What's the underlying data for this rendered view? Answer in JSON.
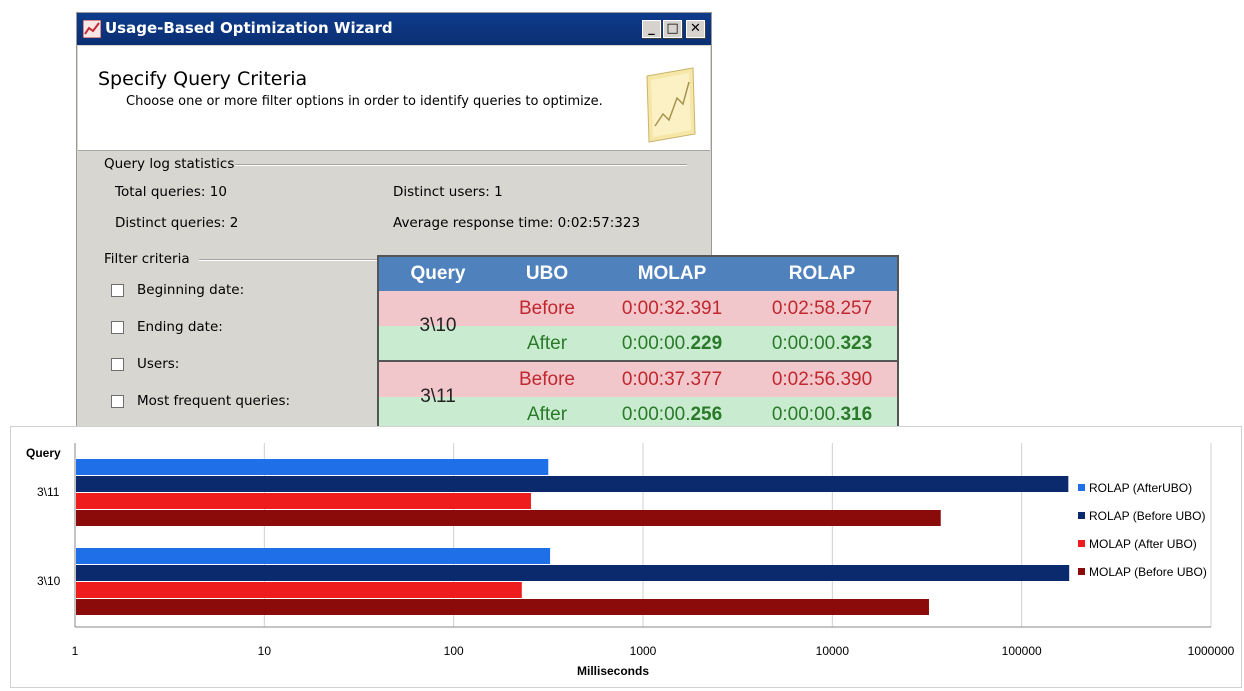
{
  "window": {
    "title": "Usage-Based Optimization Wizard",
    "min_label": "_",
    "max_label": "□",
    "close_label": "✕"
  },
  "header": {
    "title": "Specify Query Criteria",
    "subtitle": "Choose one or more filter options in order to identify queries to optimize."
  },
  "stats": {
    "section_label": "Query log statistics",
    "total_queries": "Total queries: 10",
    "distinct_users": "Distinct users: 1",
    "distinct_queries": "Distinct queries: 2",
    "avg_response": "Average response time: 0:02:57:323"
  },
  "filter": {
    "section_label": "Filter criteria",
    "options": [
      {
        "label": "Beginning date:",
        "checked": false
      },
      {
        "label": "Ending date:",
        "checked": false
      },
      {
        "label": "Users:",
        "checked": false
      },
      {
        "label": "Most frequent queries:",
        "checked": false
      }
    ]
  },
  "table": {
    "headers": [
      "Query",
      "UBO",
      "MOLAP",
      "ROLAP"
    ],
    "groups": [
      {
        "query": "3\\10",
        "rows": [
          {
            "ubo": "Before",
            "molap": "0:00:32.391",
            "rolap": "0:02:58.257"
          },
          {
            "ubo": "After",
            "molap_prefix": "0:00:00.",
            "molap_bold": "229",
            "rolap_prefix": "0:00:00.",
            "rolap_bold": "323"
          }
        ]
      },
      {
        "query": "3\\11",
        "rows": [
          {
            "ubo": "Before",
            "molap": "0:00:37.377",
            "rolap": "0:02:56.390"
          },
          {
            "ubo": "After",
            "molap_prefix": "0:00:00.",
            "molap_bold": "256",
            "rolap_prefix": "0:00:00.",
            "rolap_bold": "316"
          }
        ]
      }
    ],
    "colors": {
      "header": "#4f81bd",
      "before_bg": "#f2c7cb",
      "after_bg": "#c9ecd0",
      "before_text": "#c0282f",
      "after_text": "#2a7a2a"
    }
  },
  "chart_data": {
    "type": "bar",
    "orientation": "horizontal",
    "ylabel": "Query",
    "xlabel": "Milliseconds",
    "xscale": "log",
    "xlim": [
      1,
      1000000
    ],
    "xticks": [
      "1",
      "10",
      "100",
      "1000",
      "10000",
      "100000",
      "1000000"
    ],
    "grid": true,
    "legend_position": "right",
    "categories": [
      "3\\11",
      "3\\10"
    ],
    "series": [
      {
        "name": "ROLAP (AfterUBO)",
        "color": "#1f6fe8",
        "values": [
          316,
          323
        ]
      },
      {
        "name": "ROLAP (Before UBO)",
        "color": "#0b2a6e",
        "values": [
          176390,
          178257
        ]
      },
      {
        "name": "MOLAP (After UBO)",
        "color": "#ee1c1c",
        "values": [
          256,
          229
        ]
      },
      {
        "name": "MOLAP (Before UBO)",
        "color": "#8b0a0a",
        "values": [
          37377,
          32391
        ]
      }
    ]
  }
}
